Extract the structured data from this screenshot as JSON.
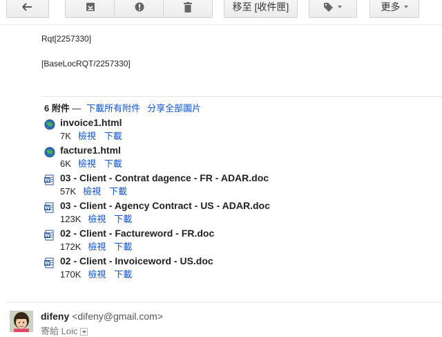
{
  "toolbar": {
    "back_icon": "back-arrow-icon",
    "archive_icon": "archive-icon",
    "spam_icon": "report-spam-icon",
    "delete_icon": "trash-icon",
    "move_label": "移至 [收件匣]",
    "labels_icon": "label-tag-icon",
    "more_label": "更多"
  },
  "message": {
    "line1": "Rqt[2257330]",
    "line2": "[BaseLocRQT/2257330]"
  },
  "attachments_header": {
    "count": "6 附件",
    "dash": " — ",
    "download_all": "下載所有附件",
    "share_all": "分享全部圖片"
  },
  "attachments": [
    {
      "name": "invoice1.html",
      "size": "7K",
      "view": "檢視",
      "download": "下載",
      "icon": "html-file-icon"
    },
    {
      "name": "facture1.html",
      "size": "6K",
      "view": "檢視",
      "download": "下載",
      "icon": "html-file-icon"
    },
    {
      "name": "03 - Client - Contrat dagence - FR - ADAR.doc",
      "size": "57K",
      "view": "檢視",
      "download": "下載",
      "icon": "word-doc-icon"
    },
    {
      "name": "03 - Client - Agency Contract - US - ADAR.doc",
      "size": "123K",
      "view": "檢視",
      "download": "下載",
      "icon": "word-doc-icon"
    },
    {
      "name": "02 - Client - Factureword - FR.doc",
      "size": "172K",
      "view": "檢視",
      "download": "下載",
      "icon": "word-doc-icon"
    },
    {
      "name": "02 - Client - Invoiceword - US.doc",
      "size": "170K",
      "view": "檢視",
      "download": "下載",
      "icon": "word-doc-icon"
    }
  ],
  "sender": {
    "name": "difeny",
    "email": "<difeny@gmail.com>",
    "recipients": "寄給 Loic"
  },
  "colors": {
    "link": "#1155cc",
    "text": "#222222",
    "button_border": "#d4d4d4"
  }
}
